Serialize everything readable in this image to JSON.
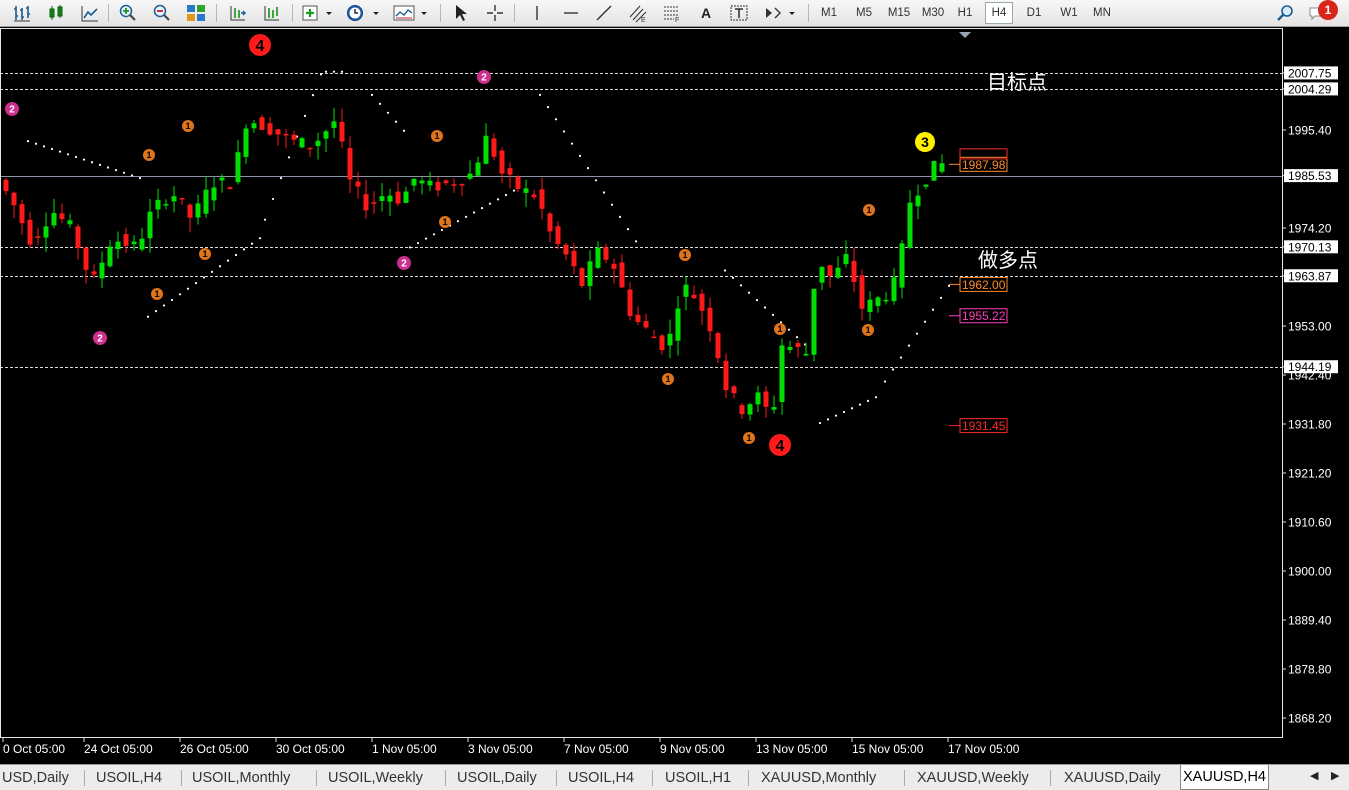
{
  "toolbar": {
    "timeframes": [
      "M1",
      "M5",
      "M15",
      "M30",
      "H1",
      "H4",
      "D1",
      "W1",
      "MN"
    ],
    "active_timeframe": "H4",
    "notification_count": "1",
    "text_tool": "A"
  },
  "chart": {
    "price_labels": [
      "2007.75",
      "2004.29",
      "1995.40",
      "1985.53",
      "1974.20",
      "1970.13",
      "1963.87",
      "1953.00",
      "1944.19",
      "1942.40",
      "1931.80",
      "1921.20",
      "1910.60",
      "1900.00",
      "1889.40",
      "1878.80",
      "1868.20"
    ],
    "time_labels": [
      "0 Oct 05:00",
      "24 Oct 05:00",
      "26 Oct 05:00",
      "30 Oct 05:00",
      "1 Nov 05:00",
      "3 Nov 05:00",
      "7 Nov 05:00",
      "9 Nov 05:00",
      "13 Nov 05:00",
      "15 Nov 05:00",
      "17 Nov 05:00"
    ],
    "annotations": {
      "target_label": "目标点",
      "long_label": "做多点"
    },
    "level_boxes": [
      "1987.98",
      "1962.00",
      "1955.22",
      "1931.45"
    ],
    "count_markers": [
      "4",
      "2",
      "1",
      "3"
    ],
    "colors": {
      "bull": "#00e000",
      "bear": "#ff1a1a",
      "grid_line": "#ffffff",
      "level_orange": "#ff8a2a",
      "level_magenta": "#ff3fbf",
      "level_red": "#ff2a2a"
    }
  },
  "tabs": [
    {
      "label": "USD,Daily"
    },
    {
      "label": "USOIL,H4"
    },
    {
      "label": "USOIL,Monthly"
    },
    {
      "label": "USOIL,Weekly"
    },
    {
      "label": "USOIL,Daily"
    },
    {
      "label": "USOIL,H4"
    },
    {
      "label": "USOIL,H1"
    },
    {
      "label": "XAUUSD,Monthly"
    },
    {
      "label": "XAUUSD,Weekly"
    },
    {
      "label": "XAUUSD,Daily"
    },
    {
      "label": "XAUUSD,H4"
    }
  ],
  "active_tab": "XAUUSD,H4"
}
